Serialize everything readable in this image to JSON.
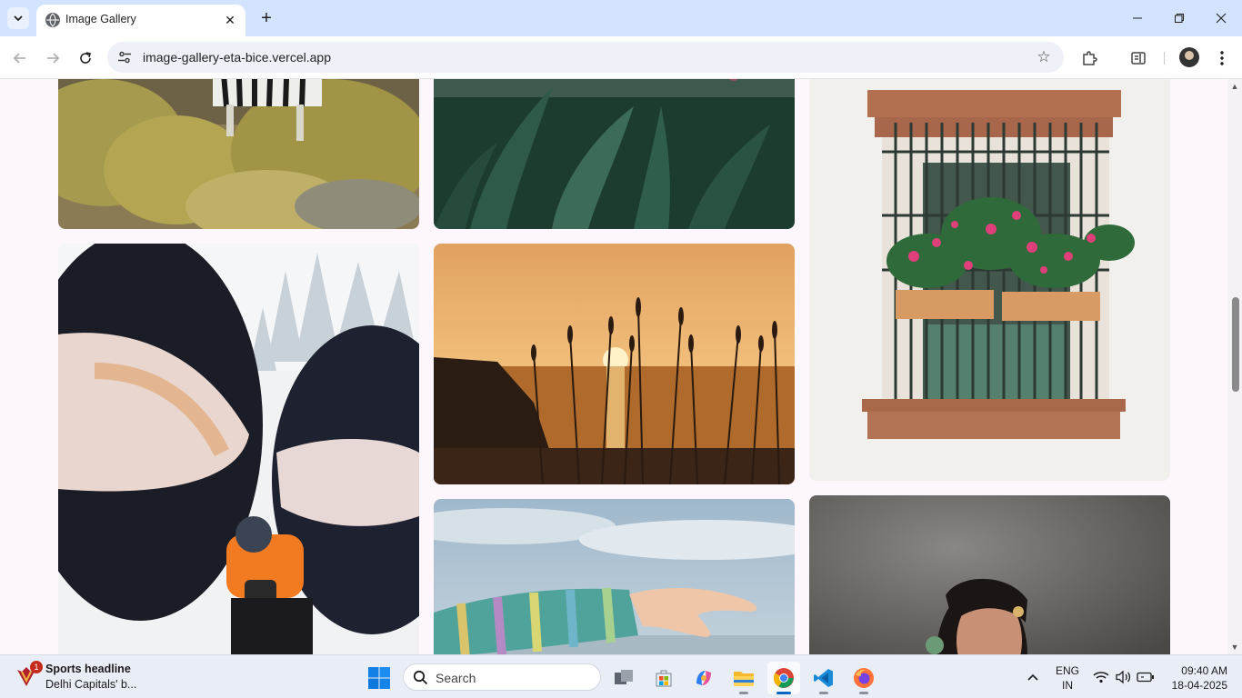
{
  "browser": {
    "tab": {
      "title": "Image Gallery"
    },
    "address": {
      "url": "image-gallery-eta-bice.vercel.app"
    }
  },
  "gallery": {
    "photos": [
      {
        "name": "zebra-grassland"
      },
      {
        "name": "green-leaves"
      },
      {
        "name": "window-flowerbox"
      },
      {
        "name": "snow-helmets-photographer"
      },
      {
        "name": "sunset-sea-grass"
      },
      {
        "name": "knit-sleeve-hand"
      },
      {
        "name": "bride-portrait"
      }
    ]
  },
  "taskbar": {
    "news": {
      "badge": "1",
      "headline": "Sports headline",
      "subtitle": "Delhi Capitals' b..."
    },
    "search": {
      "placeholder": "Search"
    },
    "language": {
      "line1": "ENG",
      "line2": "IN"
    },
    "clock": {
      "time": "09:40 AM",
      "date": "18-04-2025"
    }
  },
  "colors": {
    "accent": "#0067c0",
    "tabbar": "#d3e3fd",
    "page_bg": "#fdf7fd"
  }
}
